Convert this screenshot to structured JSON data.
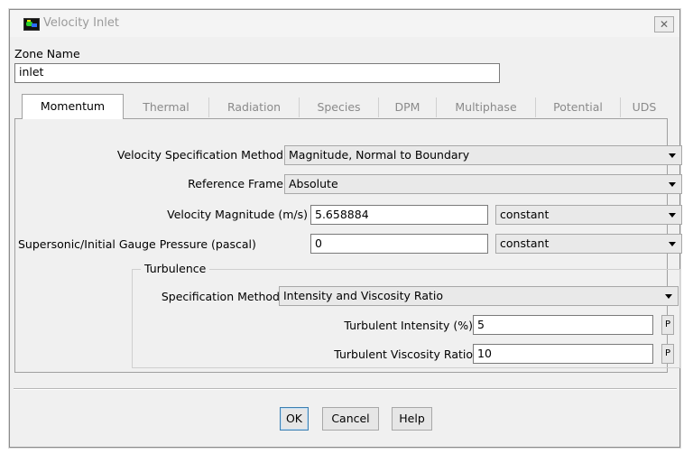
{
  "window": {
    "title": "Velocity Inlet",
    "close_glyph": "✕"
  },
  "zone": {
    "label": "Zone Name",
    "value": "inlet"
  },
  "tabs": [
    {
      "label": "Momentum",
      "active": true
    },
    {
      "label": "Thermal",
      "active": false
    },
    {
      "label": "Radiation",
      "active": false
    },
    {
      "label": "Species",
      "active": false
    },
    {
      "label": "DPM",
      "active": false
    },
    {
      "label": "Multiphase",
      "active": false
    },
    {
      "label": "Potential",
      "active": false
    },
    {
      "label": "UDS",
      "active": false
    }
  ],
  "momentum": {
    "velocity_spec": {
      "label": "Velocity Specification Method",
      "value": "Magnitude, Normal to Boundary"
    },
    "reference_frame": {
      "label": "Reference Frame",
      "value": "Absolute"
    },
    "velocity_magnitude": {
      "label": "Velocity Magnitude (m/s)",
      "value": "5.658884",
      "profile": "constant"
    },
    "gauge_pressure": {
      "label": "Supersonic/Initial Gauge Pressure (pascal)",
      "value": "0",
      "profile": "constant"
    },
    "turbulence": {
      "group_label": "Turbulence",
      "spec_method": {
        "label": "Specification Method",
        "value": "Intensity and Viscosity Ratio"
      },
      "intensity": {
        "label": "Turbulent Intensity (%)",
        "value": "5",
        "param_btn": "P"
      },
      "viscosity_ratio": {
        "label": "Turbulent Viscosity Ratio",
        "value": "10",
        "param_btn": "P"
      }
    }
  },
  "buttons": {
    "ok": "OK",
    "cancel": "Cancel",
    "help": "Help"
  },
  "colors": {
    "dialog_bg": "#f0f0f0",
    "default_button_border": "#3c7fb1",
    "disabled_text": "#8a8a8a"
  }
}
